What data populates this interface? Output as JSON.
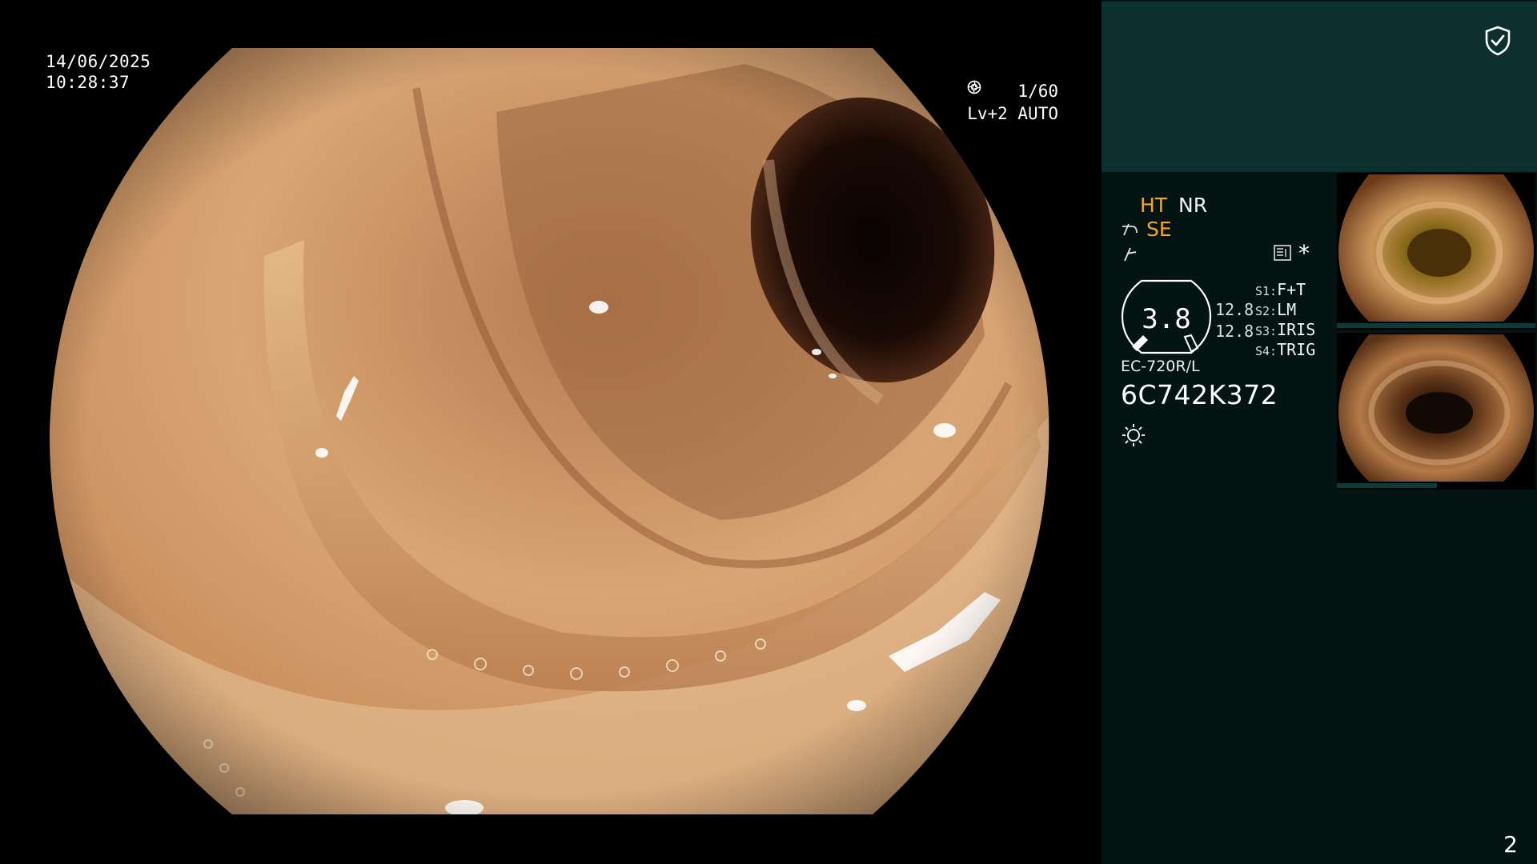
{
  "overlay": {
    "date": "14/06/2025",
    "time": "10:28:37",
    "shutter": "1/60",
    "level": "Lv+2 AUTO"
  },
  "panel": {
    "modes": {
      "ht": "HT",
      "nr": "NR",
      "se": "SE"
    },
    "icons": {
      "security": "shield-check-icon",
      "scope_angle": "scope-angle-icon",
      "focus": "focus-icon",
      "record": "book-icon",
      "asterisk": "*",
      "light": "light-icon"
    },
    "gauge_value": "3.8",
    "f_values": [
      "12.8",
      "12.8"
    ],
    "switches": [
      {
        "key": "S1:",
        "value": "F+T"
      },
      {
        "key": "S2:",
        "value": "LM"
      },
      {
        "key": "S3:",
        "value": "IRIS"
      },
      {
        "key": "S4:",
        "value": "TRIG"
      }
    ],
    "scope_model": "EC-720R/L",
    "scope_serial": "6C742K372",
    "page_number": "2"
  },
  "colors": {
    "accent_orange": "#f7a623",
    "panel_top": "#0b302d",
    "panel_bg": "#031413"
  }
}
